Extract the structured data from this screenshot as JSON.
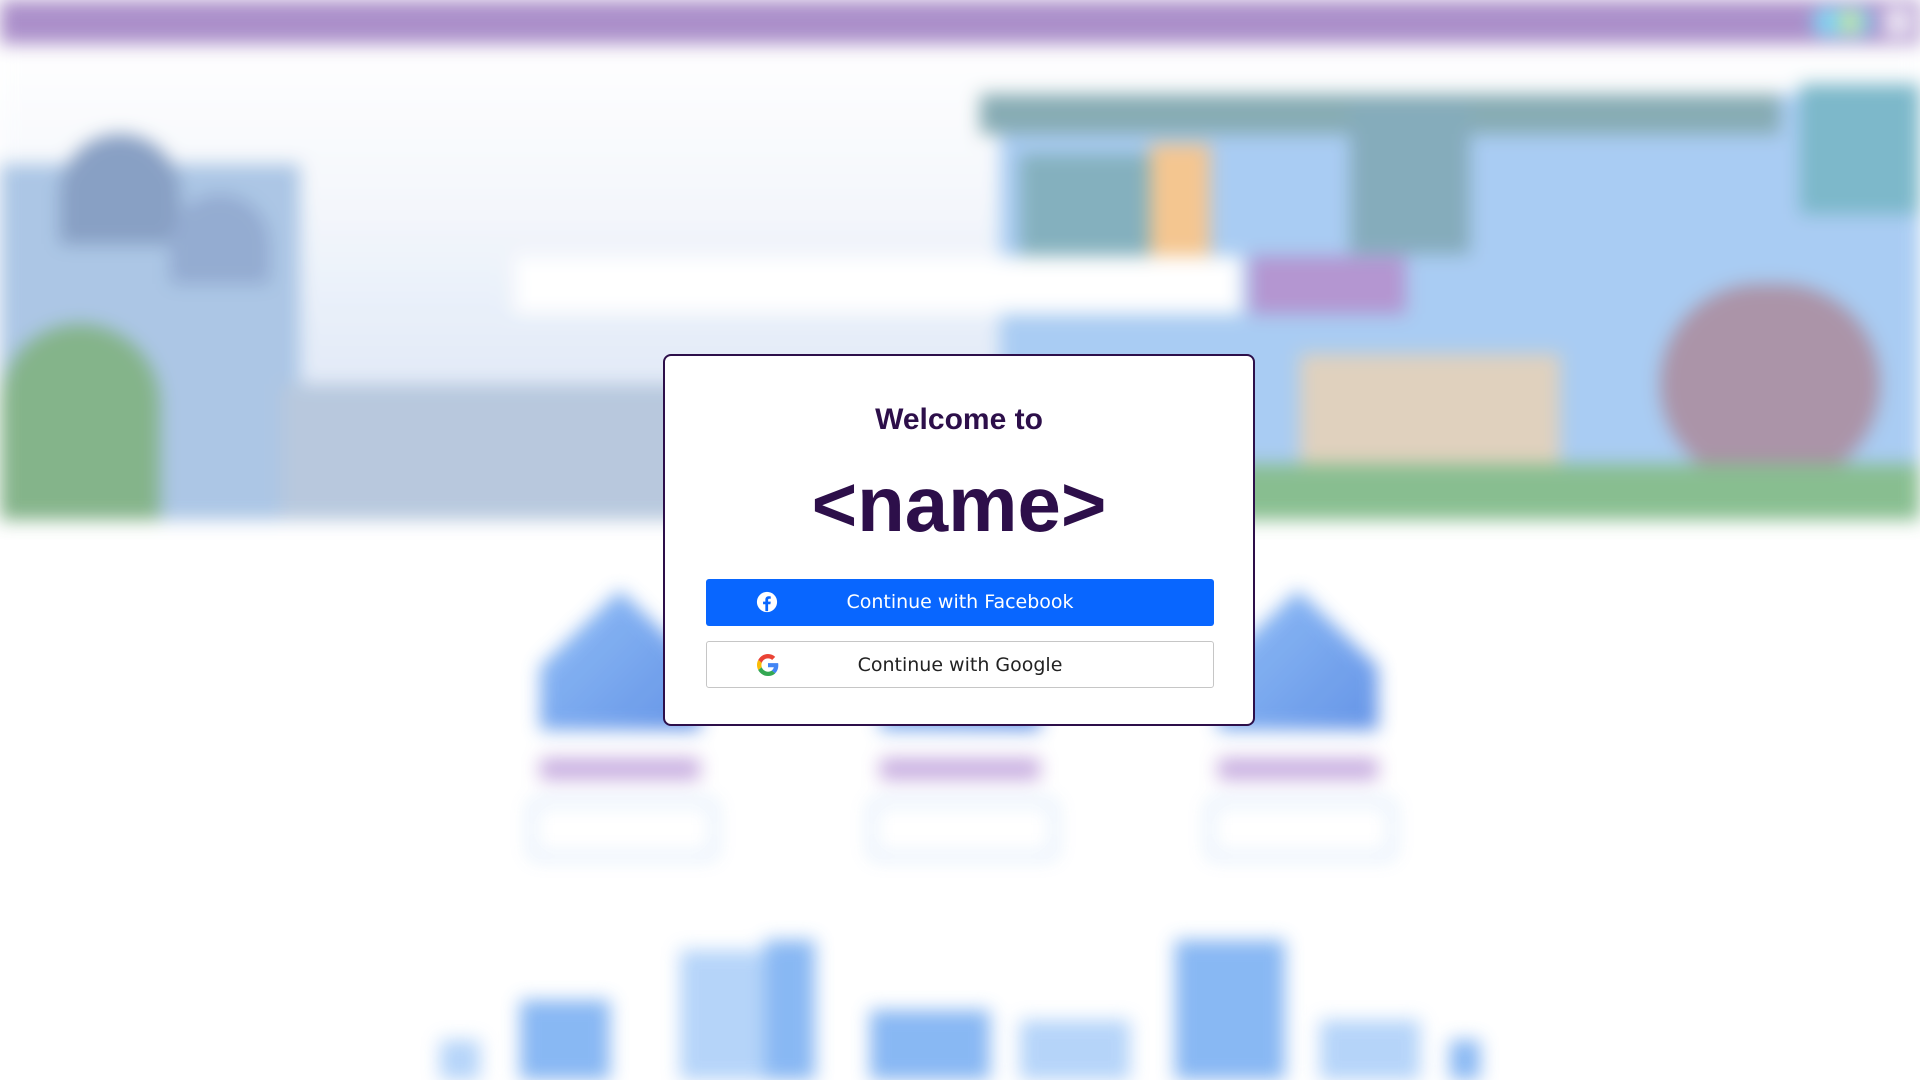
{
  "modal": {
    "welcome_text": "Welcome to",
    "brand_name": "<name>",
    "buttons": [
      {
        "label": "Continue with Facebook",
        "icon": "facebook-icon",
        "bg_color": "#0866ff",
        "text_color": "#ffffff"
      },
      {
        "label": "Continue with Google",
        "icon": "google-icon",
        "bg_color": "#ffffff",
        "text_color": "#222222"
      }
    ]
  },
  "colors": {
    "brand_purple": "#2d0f4a",
    "topbar_purple": "#8e68b8",
    "facebook_blue": "#0866ff"
  }
}
